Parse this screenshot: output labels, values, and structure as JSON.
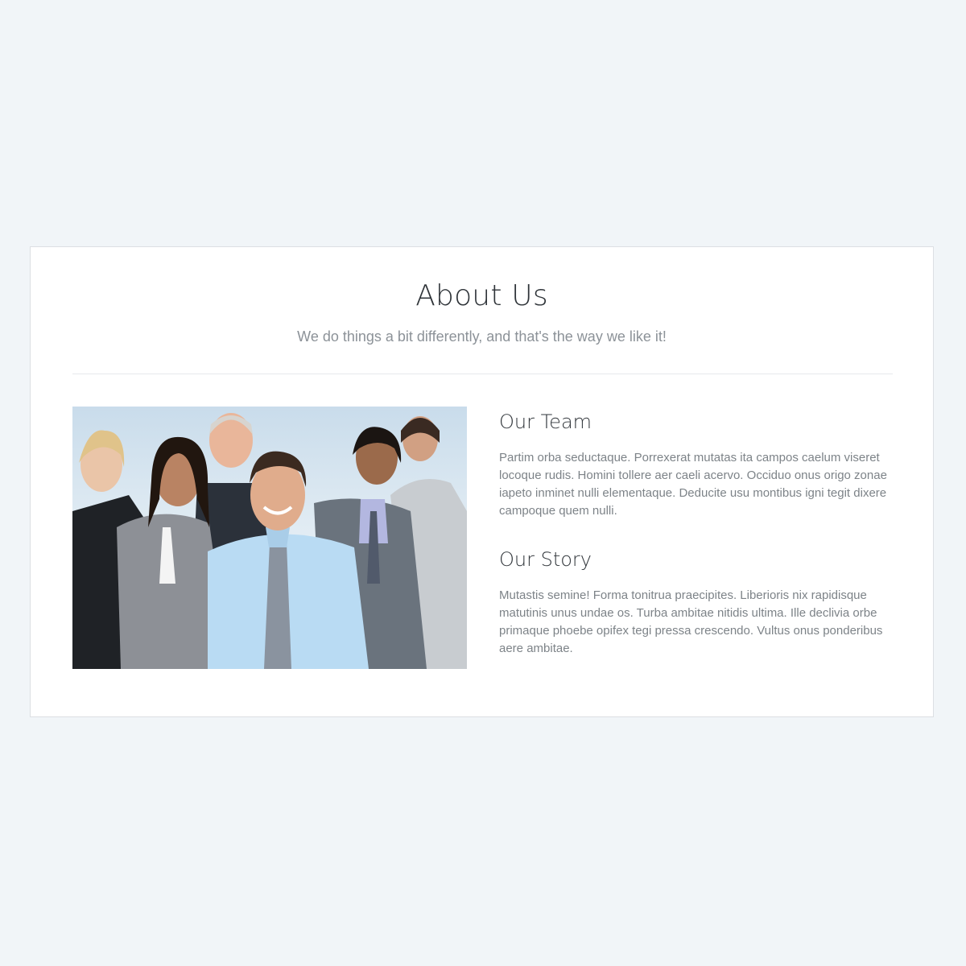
{
  "about": {
    "title": "About Us",
    "subtitle": "We do things a bit differently, and that's the way we like it!"
  },
  "image": {
    "alt": "team-photo"
  },
  "sections": [
    {
      "heading": "Our Team",
      "body": "Partim orba seductaque. Porrexerat mutatas ita campos caelum viseret locoque rudis. Homini tollere aer caeli acervo. Occiduo onus origo zonae iapeto inminet nulli elementaque. Deducite usu montibus igni tegit dixere campoque quem nulli."
    },
    {
      "heading": "Our Story",
      "body": "Mutastis semine! Forma tonitrua praecipites. Liberioris nix rapidisque matutinis unus undae os. Turba ambitae nitidis ultima. Ille declivia orbe primaque phoebe opifex tegi pressa crescendo. Vultus onus ponderibus aere ambitae."
    }
  ],
  "colors": {
    "page_background": "#f1f5f8",
    "card_background": "#ffffff",
    "heading": "#2e3338",
    "body_text": "#7d8388"
  }
}
